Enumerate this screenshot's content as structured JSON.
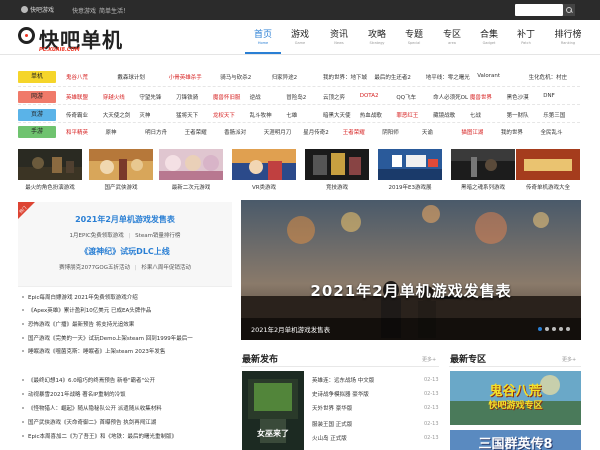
{
  "topbar": {
    "home_label": "快吧游戏",
    "links": [
      "快意游戏",
      "简单生活！"
    ]
  },
  "logo": {
    "title": "快吧单机",
    "sub": "PC.KUAI8.COM"
  },
  "nav": [
    {
      "cn": "首页",
      "en": "Home"
    },
    {
      "cn": "游戏",
      "en": "Game"
    },
    {
      "cn": "资讯",
      "en": "News"
    },
    {
      "cn": "攻略",
      "en": "Strategy"
    },
    {
      "cn": "专题",
      "en": "Special"
    },
    {
      "cn": "专区",
      "en": "area"
    },
    {
      "cn": "合集",
      "en": "Gadget"
    },
    {
      "cn": "补丁",
      "en": "Patch"
    },
    {
      "cn": "排行榜",
      "en": "Ranking"
    }
  ],
  "categories": [
    {
      "tag": "单机",
      "color": "#f5d52a",
      "items": [
        "鬼谷八荒",
        "戴森球计划",
        "小骨英雄杀手",
        "骑马与砍杀2",
        "归家异途2",
        "我的世界：地下城",
        "最后的生还者2",
        "地平线：零之曙光",
        "Valorant",
        "生化危机：村庄"
      ],
      "red": [
        0,
        2
      ]
    },
    {
      "tag": "网游",
      "color": "#f07a6a",
      "items": [
        "英雄联盟",
        "穿越火线",
        "守望先锋",
        "刀锋铁骑",
        "魔兽怀旧服",
        "逆战",
        "冒险岛2",
        "云顶之弈",
        "DOTA2",
        "QQ飞车",
        "命人必须死OL",
        "魔兽世界",
        "黑色沙漠",
        "DNF"
      ],
      "red": [
        0,
        1,
        4,
        8,
        11
      ]
    },
    {
      "tag": "页游",
      "color": "#5ab3e8",
      "items": [
        "传奇霸业",
        "大天使之剑",
        "灭神",
        "猛将天下",
        "龙权天下",
        "乱斗牧神",
        "七雄",
        "暗黑大天使",
        "热血战歌",
        "罪恶红王",
        "藏镜战歌",
        "七战",
        "第一财队",
        "乐第三国"
      ],
      "red": [
        4,
        9
      ]
    },
    {
      "tag": "手游",
      "color": "#6fc36f",
      "items": [
        "和平精英",
        "原神",
        "明日方舟",
        "王者荣耀",
        "香肠派对",
        "天涯明月刀",
        "星月传奇2",
        "王者荣耀",
        "阴阳师",
        "天谕",
        "猫图江湖",
        "我的世界",
        "全民乱斗"
      ],
      "red": [
        0,
        7,
        10
      ]
    }
  ],
  "thumbs": [
    {
      "label": "最火的角色扮演游戏"
    },
    {
      "label": "国产武侠游戏"
    },
    {
      "label": "最新二次元游戏"
    },
    {
      "label": "VR类游戏"
    },
    {
      "label": "竞技游戏"
    },
    {
      "label": "2019年E3游戏展"
    },
    {
      "label": "黑暗之魂系列游戏"
    },
    {
      "label": "传奇单机游戏大全"
    }
  ],
  "news": {
    "ribbon": "热门",
    "headline1": "2021年2月单机游戏发售表",
    "sub1a": "1月EPIC免费领取游戏",
    "sub1b": "Steam销量排行榜",
    "headline2": "《渡神纪》试玩DLC上线",
    "sub2a": "赛博朋克2077GOG五折活动",
    "sub2b": "杉果八周年促销活动",
    "list": [
      "Epic每周白嫖游戏 2021年免费领取游戏介绍",
      "《Apex英雄》累计盈利10亿美元 已成EA头牌作品",
      "恐怖游戏《广播》最新预告 将支持光追效果",
      "国产游戏《完美的一天》试玩Demo上架steam 回到1999年最后一",
      "睡眠游戏《噬菌克斯：睡眠者》上架steam 2023年发售",
      "《最终幻想14》6.0暗巧的终焉预告 新卷\"霸者\"公开",
      "动视暴雪2021年战略 著名IP重制的冷饭",
      "《怪物猎人：崛起》随从隐秘队公开 派遣随从收集材料",
      "国产武侠游戏《天命奇御二》首曝预告 执剑再闯江湖",
      "Epic本周喜加二《为了吾王》和《地铁：最后的曙光重制版》"
    ]
  },
  "hero": {
    "overlay_text": "2021年2月单机游戏发售表",
    "caption": "2021年2月单机游戏发售表"
  },
  "latest": {
    "title": "最新发布",
    "more": "更多+",
    "thumb_text": "女巫来了",
    "items": [
      {
        "name": "英雄连：远东战场 中文版",
        "date": "02-13"
      },
      {
        "name": "史诗战争模拟器 豪华版",
        "date": "02-13"
      },
      {
        "name": "天外世界 豪华版",
        "date": "02-13"
      },
      {
        "name": "服装王国 正式版",
        "date": "02-13"
      },
      {
        "name": "火山岛 正式版",
        "date": "02-13"
      }
    ]
  },
  "zone": {
    "title": "最新专区",
    "more": "更多+",
    "banner1_title": "鬼谷八荒",
    "banner1_sub": "快吧游戏专区",
    "banner2_title": "三国群英传8"
  }
}
